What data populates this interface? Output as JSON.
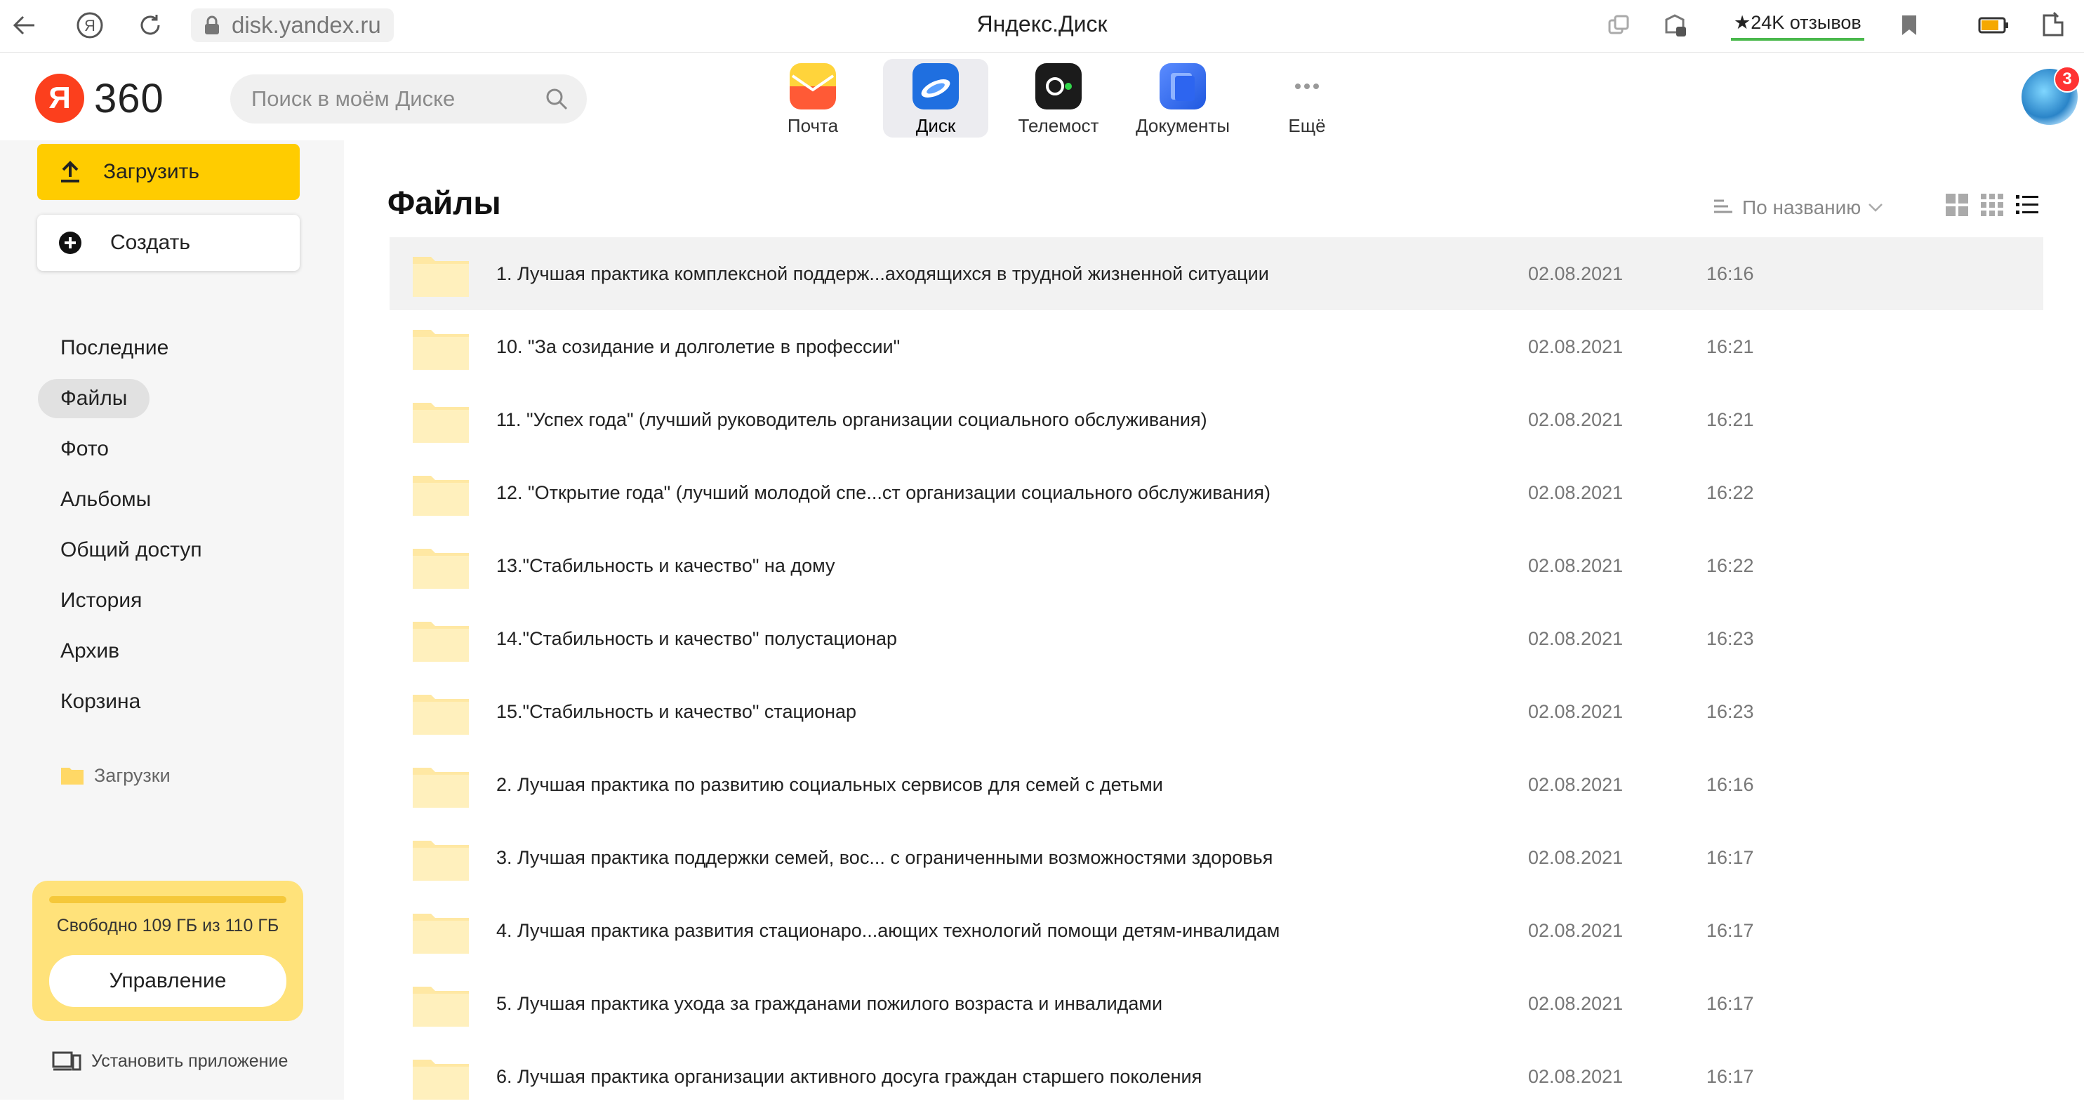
{
  "browser": {
    "url": "disk.yandex.ru",
    "tab_title": "Яндекс.Диск",
    "reviews_label": "★24K отзывов"
  },
  "header": {
    "logo_ya": "Я",
    "logo_text": "360",
    "search_placeholder": "Поиск в моём Диске",
    "services": [
      {
        "label": "Почта",
        "icon": "mail-icon"
      },
      {
        "label": "Диск",
        "icon": "disk-icon",
        "active": true
      },
      {
        "label": "Телемост",
        "icon": "telemost-icon"
      },
      {
        "label": "Документы",
        "icon": "documents-icon"
      },
      {
        "label": "Ещё",
        "icon": "more-icon"
      }
    ],
    "avatar_badge": "3"
  },
  "sidebar": {
    "upload_label": "Загрузить",
    "create_label": "Создать",
    "nav": [
      {
        "label": "Последние"
      },
      {
        "label": "Файлы",
        "active": true
      },
      {
        "label": "Фото"
      },
      {
        "label": "Альбомы"
      },
      {
        "label": "Общий доступ"
      },
      {
        "label": "История"
      },
      {
        "label": "Архив"
      },
      {
        "label": "Корзина"
      }
    ],
    "downloads_label": "Загрузки",
    "storage": {
      "text": "Свободно 109 ГБ из 110 ГБ",
      "manage_label": "Управление"
    },
    "install_label": "Установить приложение"
  },
  "main": {
    "title": "Файлы",
    "sort_label": "По названию",
    "files": [
      {
        "name": "1. Лучшая практика комплексной поддерж...аходящихся в трудной жизненной ситуации",
        "date": "02.08.2021",
        "time": "16:16"
      },
      {
        "name": "10. \"За созидание и долголетие в профессии\"",
        "date": "02.08.2021",
        "time": "16:21"
      },
      {
        "name": "11. \"Успех года\" (лучший руководитель организации социального обслуживания)",
        "date": "02.08.2021",
        "time": "16:21"
      },
      {
        "name": "12. \"Открытие года\" (лучший молодой спе...ст организации социального обслуживания)",
        "date": "02.08.2021",
        "time": "16:22"
      },
      {
        "name": "13.\"Стабильность и качество\" на дому",
        "date": "02.08.2021",
        "time": "16:22"
      },
      {
        "name": "14.\"Стабильность и качество\" полустационар",
        "date": "02.08.2021",
        "time": "16:23"
      },
      {
        "name": "15.\"Стабильность и качество\" стационар",
        "date": "02.08.2021",
        "time": "16:23"
      },
      {
        "name": "2. Лучшая практика по развитию социальных сервисов для семей с детьми",
        "date": "02.08.2021",
        "time": "16:16"
      },
      {
        "name": "3. Лучшая практика поддержки семей, вос... с ограниченными возможностями здоровья",
        "date": "02.08.2021",
        "time": "16:17"
      },
      {
        "name": "4. Лучшая практика развития стационаро...ающих технологий помощи детям-инвалидам",
        "date": "02.08.2021",
        "time": "16:17"
      },
      {
        "name": "5. Лучшая практика ухода за гражданами пожилого возраста и инвалидами",
        "date": "02.08.2021",
        "time": "16:17"
      },
      {
        "name": "6. Лучшая практика организации активного досуга граждан старшего поколения",
        "date": "02.08.2021",
        "time": "16:17"
      }
    ]
  },
  "colors": {
    "accent_yellow": "#ffcc00",
    "folder": "#ffe8a3",
    "logo_red": "#fc3f1d"
  }
}
